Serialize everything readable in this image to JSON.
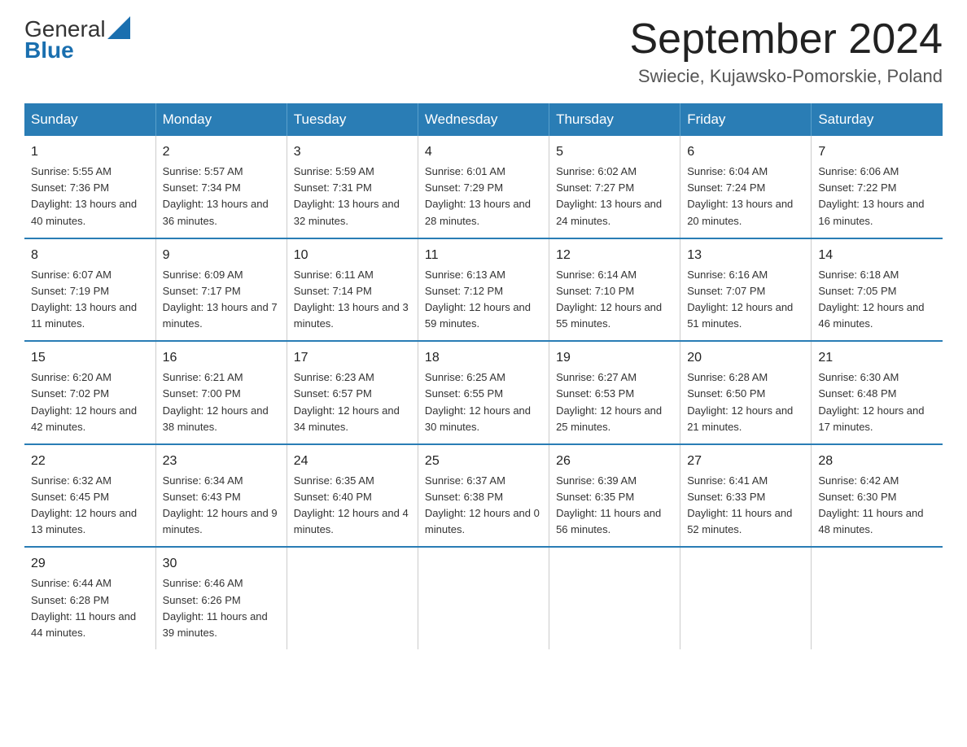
{
  "header": {
    "logo_general": "General",
    "logo_blue": "Blue",
    "month_title": "September 2024",
    "location": "Swiecie, Kujawsko-Pomorskie, Poland"
  },
  "days_of_week": [
    "Sunday",
    "Monday",
    "Tuesday",
    "Wednesday",
    "Thursday",
    "Friday",
    "Saturday"
  ],
  "weeks": [
    [
      {
        "day": "1",
        "sunrise": "Sunrise: 5:55 AM",
        "sunset": "Sunset: 7:36 PM",
        "daylight": "Daylight: 13 hours and 40 minutes."
      },
      {
        "day": "2",
        "sunrise": "Sunrise: 5:57 AM",
        "sunset": "Sunset: 7:34 PM",
        "daylight": "Daylight: 13 hours and 36 minutes."
      },
      {
        "day": "3",
        "sunrise": "Sunrise: 5:59 AM",
        "sunset": "Sunset: 7:31 PM",
        "daylight": "Daylight: 13 hours and 32 minutes."
      },
      {
        "day": "4",
        "sunrise": "Sunrise: 6:01 AM",
        "sunset": "Sunset: 7:29 PM",
        "daylight": "Daylight: 13 hours and 28 minutes."
      },
      {
        "day": "5",
        "sunrise": "Sunrise: 6:02 AM",
        "sunset": "Sunset: 7:27 PM",
        "daylight": "Daylight: 13 hours and 24 minutes."
      },
      {
        "day": "6",
        "sunrise": "Sunrise: 6:04 AM",
        "sunset": "Sunset: 7:24 PM",
        "daylight": "Daylight: 13 hours and 20 minutes."
      },
      {
        "day": "7",
        "sunrise": "Sunrise: 6:06 AM",
        "sunset": "Sunset: 7:22 PM",
        "daylight": "Daylight: 13 hours and 16 minutes."
      }
    ],
    [
      {
        "day": "8",
        "sunrise": "Sunrise: 6:07 AM",
        "sunset": "Sunset: 7:19 PM",
        "daylight": "Daylight: 13 hours and 11 minutes."
      },
      {
        "day": "9",
        "sunrise": "Sunrise: 6:09 AM",
        "sunset": "Sunset: 7:17 PM",
        "daylight": "Daylight: 13 hours and 7 minutes."
      },
      {
        "day": "10",
        "sunrise": "Sunrise: 6:11 AM",
        "sunset": "Sunset: 7:14 PM",
        "daylight": "Daylight: 13 hours and 3 minutes."
      },
      {
        "day": "11",
        "sunrise": "Sunrise: 6:13 AM",
        "sunset": "Sunset: 7:12 PM",
        "daylight": "Daylight: 12 hours and 59 minutes."
      },
      {
        "day": "12",
        "sunrise": "Sunrise: 6:14 AM",
        "sunset": "Sunset: 7:10 PM",
        "daylight": "Daylight: 12 hours and 55 minutes."
      },
      {
        "day": "13",
        "sunrise": "Sunrise: 6:16 AM",
        "sunset": "Sunset: 7:07 PM",
        "daylight": "Daylight: 12 hours and 51 minutes."
      },
      {
        "day": "14",
        "sunrise": "Sunrise: 6:18 AM",
        "sunset": "Sunset: 7:05 PM",
        "daylight": "Daylight: 12 hours and 46 minutes."
      }
    ],
    [
      {
        "day": "15",
        "sunrise": "Sunrise: 6:20 AM",
        "sunset": "Sunset: 7:02 PM",
        "daylight": "Daylight: 12 hours and 42 minutes."
      },
      {
        "day": "16",
        "sunrise": "Sunrise: 6:21 AM",
        "sunset": "Sunset: 7:00 PM",
        "daylight": "Daylight: 12 hours and 38 minutes."
      },
      {
        "day": "17",
        "sunrise": "Sunrise: 6:23 AM",
        "sunset": "Sunset: 6:57 PM",
        "daylight": "Daylight: 12 hours and 34 minutes."
      },
      {
        "day": "18",
        "sunrise": "Sunrise: 6:25 AM",
        "sunset": "Sunset: 6:55 PM",
        "daylight": "Daylight: 12 hours and 30 minutes."
      },
      {
        "day": "19",
        "sunrise": "Sunrise: 6:27 AM",
        "sunset": "Sunset: 6:53 PM",
        "daylight": "Daylight: 12 hours and 25 minutes."
      },
      {
        "day": "20",
        "sunrise": "Sunrise: 6:28 AM",
        "sunset": "Sunset: 6:50 PM",
        "daylight": "Daylight: 12 hours and 21 minutes."
      },
      {
        "day": "21",
        "sunrise": "Sunrise: 6:30 AM",
        "sunset": "Sunset: 6:48 PM",
        "daylight": "Daylight: 12 hours and 17 minutes."
      }
    ],
    [
      {
        "day": "22",
        "sunrise": "Sunrise: 6:32 AM",
        "sunset": "Sunset: 6:45 PM",
        "daylight": "Daylight: 12 hours and 13 minutes."
      },
      {
        "day": "23",
        "sunrise": "Sunrise: 6:34 AM",
        "sunset": "Sunset: 6:43 PM",
        "daylight": "Daylight: 12 hours and 9 minutes."
      },
      {
        "day": "24",
        "sunrise": "Sunrise: 6:35 AM",
        "sunset": "Sunset: 6:40 PM",
        "daylight": "Daylight: 12 hours and 4 minutes."
      },
      {
        "day": "25",
        "sunrise": "Sunrise: 6:37 AM",
        "sunset": "Sunset: 6:38 PM",
        "daylight": "Daylight: 12 hours and 0 minutes."
      },
      {
        "day": "26",
        "sunrise": "Sunrise: 6:39 AM",
        "sunset": "Sunset: 6:35 PM",
        "daylight": "Daylight: 11 hours and 56 minutes."
      },
      {
        "day": "27",
        "sunrise": "Sunrise: 6:41 AM",
        "sunset": "Sunset: 6:33 PM",
        "daylight": "Daylight: 11 hours and 52 minutes."
      },
      {
        "day": "28",
        "sunrise": "Sunrise: 6:42 AM",
        "sunset": "Sunset: 6:30 PM",
        "daylight": "Daylight: 11 hours and 48 minutes."
      }
    ],
    [
      {
        "day": "29",
        "sunrise": "Sunrise: 6:44 AM",
        "sunset": "Sunset: 6:28 PM",
        "daylight": "Daylight: 11 hours and 44 minutes."
      },
      {
        "day": "30",
        "sunrise": "Sunrise: 6:46 AM",
        "sunset": "Sunset: 6:26 PM",
        "daylight": "Daylight: 11 hours and 39 minutes."
      },
      null,
      null,
      null,
      null,
      null
    ]
  ]
}
